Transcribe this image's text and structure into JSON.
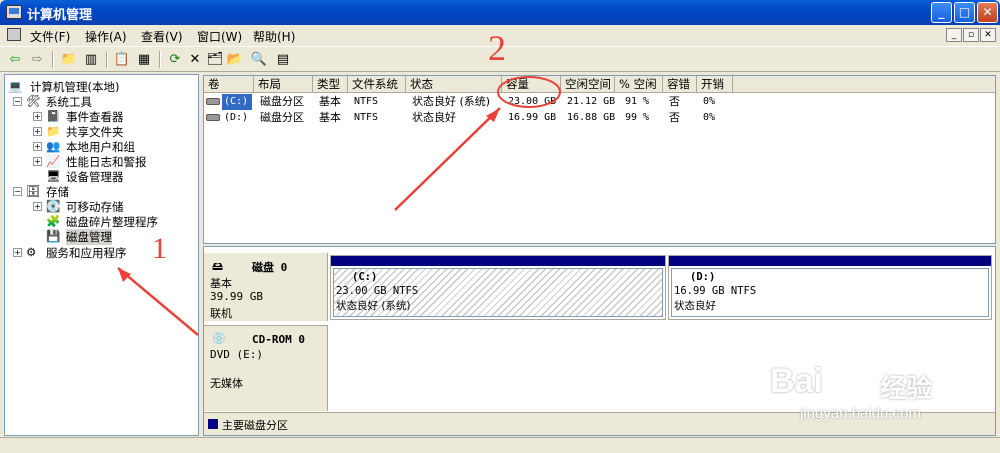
{
  "window": {
    "title": "计算机管理"
  },
  "menu": [
    "文件(F)",
    "操作(A)",
    "查看(V)",
    "窗口(W)",
    "帮助(H)"
  ],
  "tree": {
    "root": "计算机管理(本地)",
    "system_tools": "系统工具",
    "event_viewer": "事件查看器",
    "shared_folders": "共享文件夹",
    "local_users": "本地用户和组",
    "perf_logs": "性能日志和警报",
    "device_manager": "设备管理器",
    "storage": "存储",
    "removable": "可移动存储",
    "defrag": "磁盘碎片整理程序",
    "disk_mgmt": "磁盘管理",
    "services": "服务和应用程序"
  },
  "volumes": {
    "headers": [
      "卷",
      "布局",
      "类型",
      "文件系统",
      "状态",
      "容量",
      "空闲空间",
      "% 空闲",
      "容错",
      "开销"
    ],
    "rows": [
      [
        "(C:)",
        "磁盘分区",
        "基本",
        "NTFS",
        "状态良好 (系统)",
        "23.00 GB",
        "21.12 GB",
        "91 %",
        "否",
        "0%"
      ],
      [
        "(D:)",
        "磁盘分区",
        "基本",
        "NTFS",
        "状态良好",
        "16.99 GB",
        "16.88 GB",
        "99 %",
        "否",
        "0%"
      ]
    ]
  },
  "disks": {
    "disk0": {
      "name": "磁盘 0",
      "type": "基本",
      "size": "39.99 GB",
      "status": "联机"
    },
    "c": {
      "name": "(C:)",
      "size": "23.00 GB NTFS",
      "status": "状态良好 (系统)"
    },
    "d": {
      "name": "(D:)",
      "size": "16.99 GB NTFS",
      "status": "状态良好"
    },
    "cdrom": {
      "name": "CD-ROM 0",
      "drive": "DVD (E:)",
      "status": "无媒体"
    },
    "legend": "主要磁盘分区"
  },
  "annotations": {
    "one": "1",
    "two": "2"
  },
  "watermark": {
    "brand": "Bai",
    "suffix": "经验",
    "url": "jingyan.baidu.com"
  },
  "colors": {
    "title_blue": "#0a5fd8",
    "primary_partition": "#000080",
    "annotation_red": "#e8433a"
  }
}
